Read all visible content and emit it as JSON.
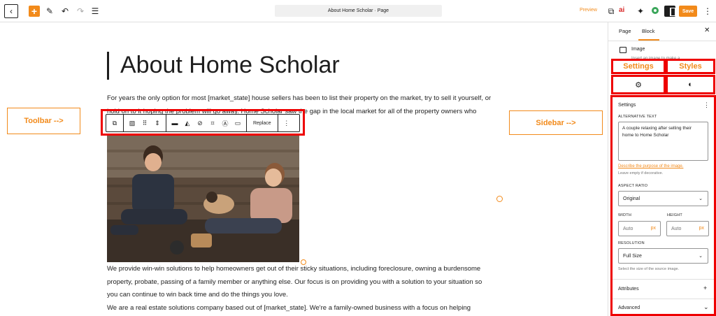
{
  "topbar": {
    "page_title": "About Home Scholar · Page",
    "preview_label": "Preview",
    "save_label": "Save",
    "ai_label": "ai"
  },
  "content": {
    "heading": "About Home Scholar",
    "para1": "For years the only option for most [market_state] house sellers has been to list their property on the market, try to sell it yourself, or hold on to it hoping the problem will go away. Home Scholar saw the gap in the local market for all of the property owners who don't",
    "para2": "We provide win-win solutions to help homeowners get out of their sticky situations, including foreclosure, owning a burdensome property, probate, passing of a family member or anything else. Our focus is on providing you with a solution to your situation so you can continue to win back time and do the things you love.",
    "para3": "We are a real estate solutions company based out of [market_state]. We're a family-owned business with a focus on helping"
  },
  "block_toolbar": {
    "replace_label": "Replace"
  },
  "annotations": {
    "toolbar": "Toolbar -->",
    "sidebar": "Sidebar -->",
    "settings": "Settings",
    "styles": "Styles"
  },
  "sidebar": {
    "tab_page": "Page",
    "tab_block": "Block",
    "block_name": "Image",
    "block_desc": "Insert an image to make a",
    "settings_title": "Settings",
    "alt_text_label": "ALTERNATIVE TEXT",
    "alt_text_value": "A couple relaxing after selling their home to Home Scholar",
    "alt_link": "Describe the purpose of the image.",
    "alt_help": "Leave empty if decorative.",
    "aspect_label": "ASPECT RATIO",
    "aspect_value": "Original",
    "width_label": "WIDTH",
    "height_label": "HEIGHT",
    "width_placeholder": "Auto",
    "height_placeholder": "Auto",
    "unit": "px",
    "resolution_label": "RESOLUTION",
    "resolution_value": "Full Size",
    "resolution_help": "Select the size of the source image.",
    "attributes_label": "Attributes",
    "advanced_label": "Advanced"
  },
  "colors": {
    "accent": "#f28a1a",
    "highlight": "#e00000"
  }
}
